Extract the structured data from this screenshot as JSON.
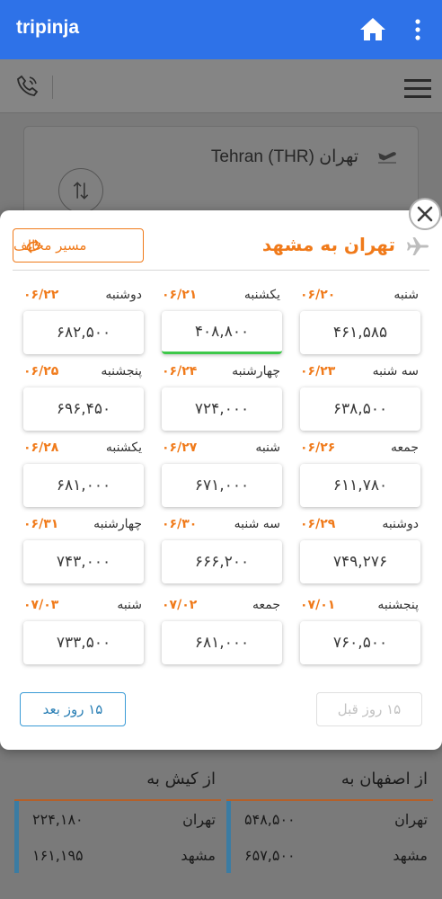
{
  "app": {
    "brand": "tripinja"
  },
  "search": {
    "from_label": "تهران (Tehran (THR"
  },
  "modal": {
    "route_title": "تهران به مشهد",
    "reverse_label": "مسیر مخالف",
    "days": [
      {
        "name": "شنبه",
        "date": "۰۶/۲۰",
        "price": "۴۶۱,۵۸۵",
        "selected": false
      },
      {
        "name": "یکشنبه",
        "date": "۰۶/۲۱",
        "price": "۴۰۸,۸۰۰",
        "selected": true
      },
      {
        "name": "دوشنبه",
        "date": "۰۶/۲۲",
        "price": "۶۸۲,۵۰۰",
        "selected": false
      },
      {
        "name": "سه شنبه",
        "date": "۰۶/۲۳",
        "price": "۶۳۸,۵۰۰",
        "selected": false
      },
      {
        "name": "چهارشنبه",
        "date": "۰۶/۲۴",
        "price": "۷۲۴,۰۰۰",
        "selected": false
      },
      {
        "name": "پنجشنبه",
        "date": "۰۶/۲۵",
        "price": "۶۹۶,۴۵۰",
        "selected": false
      },
      {
        "name": "جمعه",
        "date": "۰۶/۲۶",
        "price": "۶۱۱,۷۸۰",
        "selected": false
      },
      {
        "name": "شنبه",
        "date": "۰۶/۲۷",
        "price": "۶۷۱,۰۰۰",
        "selected": false
      },
      {
        "name": "یکشنبه",
        "date": "۰۶/۲۸",
        "price": "۶۸۱,۰۰۰",
        "selected": false
      },
      {
        "name": "دوشنبه",
        "date": "۰۶/۲۹",
        "price": "۷۴۹,۲۷۶",
        "selected": false
      },
      {
        "name": "سه شنبه",
        "date": "۰۶/۳۰",
        "price": "۶۶۶,۲۰۰",
        "selected": false
      },
      {
        "name": "چهارشنبه",
        "date": "۰۶/۳۱",
        "price": "۷۴۳,۰۰۰",
        "selected": false
      },
      {
        "name": "پنجشنبه",
        "date": "۰۷/۰۱",
        "price": "۷۶۰,۵۰۰",
        "selected": false
      },
      {
        "name": "جمعه",
        "date": "۰۷/۰۲",
        "price": "۶۸۱,۰۰۰",
        "selected": false
      },
      {
        "name": "شنبه",
        "date": "۰۷/۰۳",
        "price": "۷۳۳,۵۰۰",
        "selected": false
      }
    ],
    "prev_label": "۱۵ روز قبل",
    "next_label": "۱۵ روز بعد"
  },
  "destinations": {
    "isfahan": {
      "title": "از اصفهان به",
      "rows": [
        {
          "city": "تهران",
          "price": "۵۴۸,۵۰۰"
        },
        {
          "city": "مشهد",
          "price": "۶۵۷,۵۰۰"
        }
      ]
    },
    "kish": {
      "title": "از کیش به",
      "rows": [
        {
          "city": "تهران",
          "price": "۲۲۴,۱۸۰"
        },
        {
          "city": "مشهد",
          "price": "۱۶۱,۱۹۵"
        }
      ]
    }
  },
  "colors": {
    "accent": "#f07a1a",
    "appbar": "#2e72e8",
    "selected": "#3ec84a",
    "next_border": "#3a9bd6"
  }
}
